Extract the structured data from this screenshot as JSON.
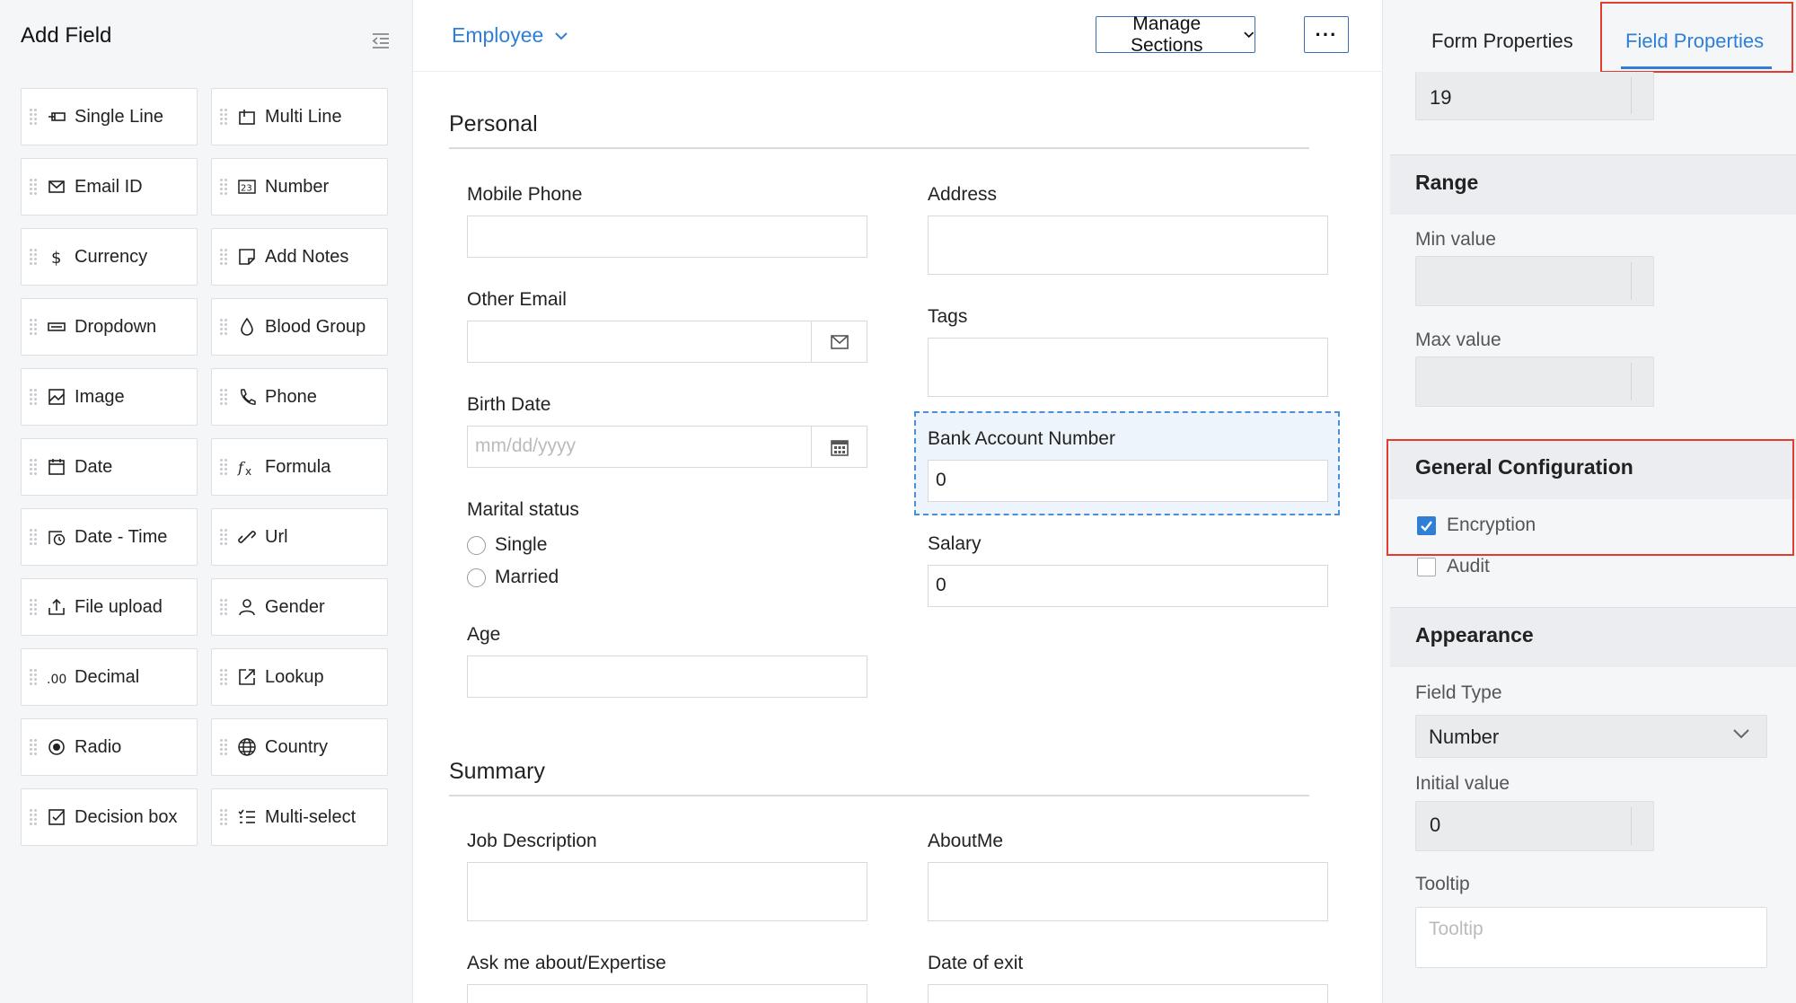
{
  "palette": {
    "title": "Add Field",
    "items": [
      {
        "label": "Single Line"
      },
      {
        "label": "Multi Line"
      },
      {
        "label": "Email ID"
      },
      {
        "label": "Number"
      },
      {
        "label": "Currency"
      },
      {
        "label": "Add Notes"
      },
      {
        "label": "Dropdown"
      },
      {
        "label": "Blood Group"
      },
      {
        "label": "Image"
      },
      {
        "label": "Phone"
      },
      {
        "label": "Date"
      },
      {
        "label": "Formula"
      },
      {
        "label": "Date - Time"
      },
      {
        "label": "Url"
      },
      {
        "label": "File upload"
      },
      {
        "label": "Gender"
      },
      {
        "label": "Decimal"
      },
      {
        "label": "Lookup"
      },
      {
        "label": "Radio"
      },
      {
        "label": "Country"
      },
      {
        "label": "Decision box"
      },
      {
        "label": "Multi-select"
      }
    ]
  },
  "form": {
    "name": "Employee",
    "manage_sections": "Manage Sections",
    "more": "···",
    "sections": {
      "personal": {
        "title": "Personal",
        "mobile_phone": "Mobile Phone",
        "other_email": "Other Email",
        "birth_date": "Birth Date",
        "birth_date_placeholder": "mm/dd/yyyy",
        "marital_status": "Marital status",
        "marital_options": [
          "Single",
          "Married"
        ],
        "age": "Age",
        "address": "Address",
        "tags": "Tags",
        "bank_account_number": "Bank Account Number",
        "bank_account_value": "0",
        "salary": "Salary",
        "salary_value": "0"
      },
      "summary": {
        "title": "Summary",
        "job_description": "Job Description",
        "about_me": "AboutMe",
        "ask_me_about": "Ask me about/Expertise",
        "date_of_exit": "Date of exit"
      }
    }
  },
  "properties": {
    "tabs": {
      "form": "Form Properties",
      "field": "Field Properties"
    },
    "top_value": "19",
    "range": {
      "title": "Range",
      "min_label": "Min value",
      "max_label": "Max value"
    },
    "general": {
      "title": "General Configuration",
      "encryption": "Encryption",
      "encryption_checked": true,
      "audit": "Audit",
      "audit_checked": false
    },
    "appearance": {
      "title": "Appearance",
      "field_type_label": "Field Type",
      "field_type_value": "Number",
      "initial_value_label": "Initial value",
      "initial_value": "0",
      "tooltip_label": "Tooltip",
      "tooltip_placeholder": "Tooltip"
    }
  },
  "colors": {
    "accent": "#2f7fd6",
    "highlight": "#e53a2e"
  }
}
